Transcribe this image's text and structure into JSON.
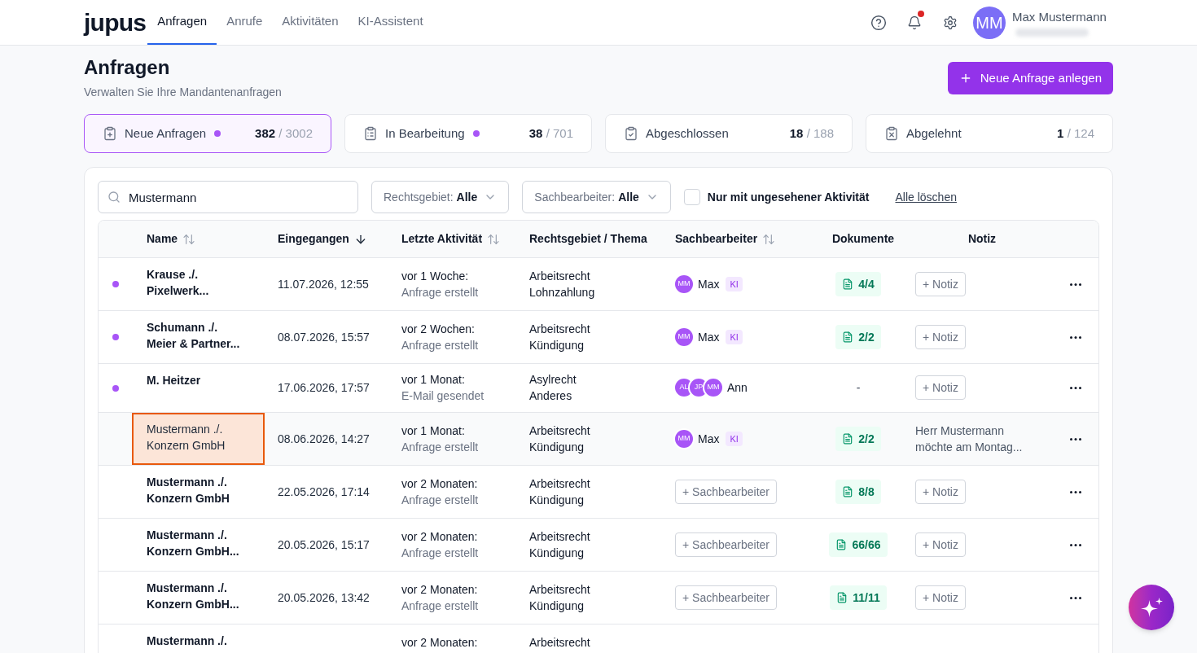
{
  "header": {
    "logo": "jupus",
    "nav": [
      {
        "label": "Anfragen",
        "selected": true
      },
      {
        "label": "Anrufe",
        "selected": false
      },
      {
        "label": "Aktivitäten",
        "selected": false
      },
      {
        "label": "KI-Assistent",
        "selected": false
      }
    ],
    "notifications_unread": true,
    "user": {
      "initials": "MM",
      "name": "Max Mustermann"
    }
  },
  "page": {
    "title": "Anfragen",
    "subtitle": "Verwalten Sie Ihre Mandantenanfragen",
    "primary_button": "Neue Anfrage anlegen"
  },
  "status_tabs": [
    {
      "kind": "new",
      "label": "Neue Anfragen",
      "unseen": true,
      "count": "382",
      "total": "/ 3002",
      "selected": true
    },
    {
      "kind": "in_progress",
      "label": "In Bearbeitung",
      "unseen": true,
      "count": "38",
      "total": "/ 701",
      "selected": false
    },
    {
      "kind": "closed",
      "label": "Abgeschlossen",
      "unseen": false,
      "count": "18",
      "total": "/ 188",
      "selected": false
    },
    {
      "kind": "rejected",
      "label": "Abgelehnt",
      "unseen": false,
      "count": "1",
      "total": "/ 124",
      "selected": false
    }
  ],
  "filters": {
    "search": {
      "value": "Mustermann"
    },
    "dropdowns": [
      {
        "label": "Rechtsgebiet:",
        "value": "Alle"
      },
      {
        "label": "Sachbearbeiter:",
        "value": "Alle"
      }
    ],
    "unseen_only": {
      "label": "Nur mit ungesehener Aktivität",
      "checked": false
    },
    "clear_link": "Alle löschen"
  },
  "table": {
    "columns": [
      {
        "label": "Name",
        "sortable": true,
        "sorted": false
      },
      {
        "label": "Eingegangen",
        "sortable": true,
        "sorted": true
      },
      {
        "label": "Letzte Aktivität",
        "sortable": true,
        "sorted": false
      },
      {
        "label": "Rechtsgebiet / Thema",
        "sortable": false
      },
      {
        "label": "Sachbearbeiter",
        "sortable": true,
        "sorted": false
      },
      {
        "label": "Dokumente",
        "sortable": false
      },
      {
        "label": "Notiz",
        "sortable": false
      }
    ],
    "rows": [
      {
        "unseen": true,
        "selected": false,
        "name_lines": [
          "Krause ./.",
          "Pixelwerk..."
        ],
        "received": "11.07.2026, 12:55",
        "activity": "vor 1 Woche:",
        "activity_detail": "Anfrage erstellt",
        "area": "Arbeitsrecht",
        "topic": "Lohnzahlung",
        "assignee": {
          "kind": "assigned",
          "avatars": [
            "MM"
          ],
          "name": "Max",
          "badge": "KI"
        },
        "documents": {
          "kind": "count",
          "label": "4/4"
        },
        "note": {
          "kind": "button",
          "label": "+ Notiz"
        },
        "has_menu": true
      },
      {
        "unseen": true,
        "selected": false,
        "name_lines": [
          "Schumann ./.",
          "Meier & Partner..."
        ],
        "received": "08.07.2026, 15:57",
        "activity": "vor 2 Wochen:",
        "activity_detail": "Anfrage erstellt",
        "area": "Arbeitsrecht",
        "topic": "Kündigung",
        "assignee": {
          "kind": "assigned",
          "avatars": [
            "MM"
          ],
          "name": "Max",
          "badge": "KI"
        },
        "documents": {
          "kind": "count",
          "label": "2/2"
        },
        "note": {
          "kind": "button",
          "label": "+ Notiz"
        },
        "has_menu": true
      },
      {
        "unseen": true,
        "selected": false,
        "name_lines": [
          "M. Heitzer"
        ],
        "received": "17.06.2026, 17:57",
        "activity": "vor 1 Monat:",
        "activity_detail": "E-Mail gesendet",
        "area": "Asylrecht",
        "topic": "Anderes",
        "assignee": {
          "kind": "assigned",
          "avatars": [
            "AL",
            "JP",
            "MM"
          ],
          "name": "Ann"
        },
        "documents": {
          "kind": "none",
          "label": "-"
        },
        "note": {
          "kind": "button",
          "label": "+ Notiz"
        },
        "has_menu": true
      },
      {
        "unseen": false,
        "selected": true,
        "name_lines": [
          "Mustermann ./.",
          "Konzern GmbH"
        ],
        "received": "08.06.2026, 14:27",
        "activity": "vor 1 Monat:",
        "activity_detail": "Anfrage erstellt",
        "area": "Arbeitsrecht",
        "topic": "Kündigung",
        "assignee": {
          "kind": "assigned",
          "avatars": [
            "MM"
          ],
          "name": "Max",
          "badge": "KI"
        },
        "documents": {
          "kind": "count",
          "label": "2/2"
        },
        "note": {
          "kind": "text",
          "lines": [
            "Herr Mustermann",
            "möchte am Montag..."
          ]
        },
        "has_menu": true
      },
      {
        "unseen": false,
        "selected": false,
        "name_lines": [
          "Mustermann ./.",
          "Konzern GmbH"
        ],
        "received": "22.05.2026, 17:14",
        "activity": "vor 2 Monaten:",
        "activity_detail": "Anfrage erstellt",
        "area": "Arbeitsrecht",
        "topic": "Kündigung",
        "assignee": {
          "kind": "unassigned",
          "label": "+ Sachbearbeiter"
        },
        "documents": {
          "kind": "count",
          "label": "8/8"
        },
        "note": {
          "kind": "button",
          "label": "+ Notiz"
        },
        "has_menu": true
      },
      {
        "unseen": false,
        "selected": false,
        "name_lines": [
          "Mustermann ./.",
          "Konzern GmbH..."
        ],
        "received": "20.05.2026, 15:17",
        "activity": "vor 2 Monaten:",
        "activity_detail": "Anfrage erstellt",
        "area": "Arbeitsrecht",
        "topic": "Kündigung",
        "assignee": {
          "kind": "unassigned",
          "label": "+ Sachbearbeiter"
        },
        "documents": {
          "kind": "count",
          "label": "66/66"
        },
        "note": {
          "kind": "button",
          "label": "+ Notiz"
        },
        "has_menu": true
      },
      {
        "unseen": false,
        "selected": false,
        "name_lines": [
          "Mustermann ./.",
          "Konzern GmbH..."
        ],
        "received": "20.05.2026, 13:42",
        "activity": "vor 2 Monaten:",
        "activity_detail": "Anfrage erstellt",
        "area": "Arbeitsrecht",
        "topic": "Kündigung",
        "assignee": {
          "kind": "unassigned",
          "label": "+ Sachbearbeiter"
        },
        "documents": {
          "kind": "count",
          "label": "11/11"
        },
        "note": {
          "kind": "button",
          "label": "+ Notiz"
        },
        "has_menu": true
      },
      {
        "unseen": false,
        "selected": false,
        "name_lines": [
          "Mustermann ./."
        ],
        "activity": "vor 2 Monaten:",
        "area": "Arbeitsrecht",
        "has_menu": false
      }
    ]
  }
}
